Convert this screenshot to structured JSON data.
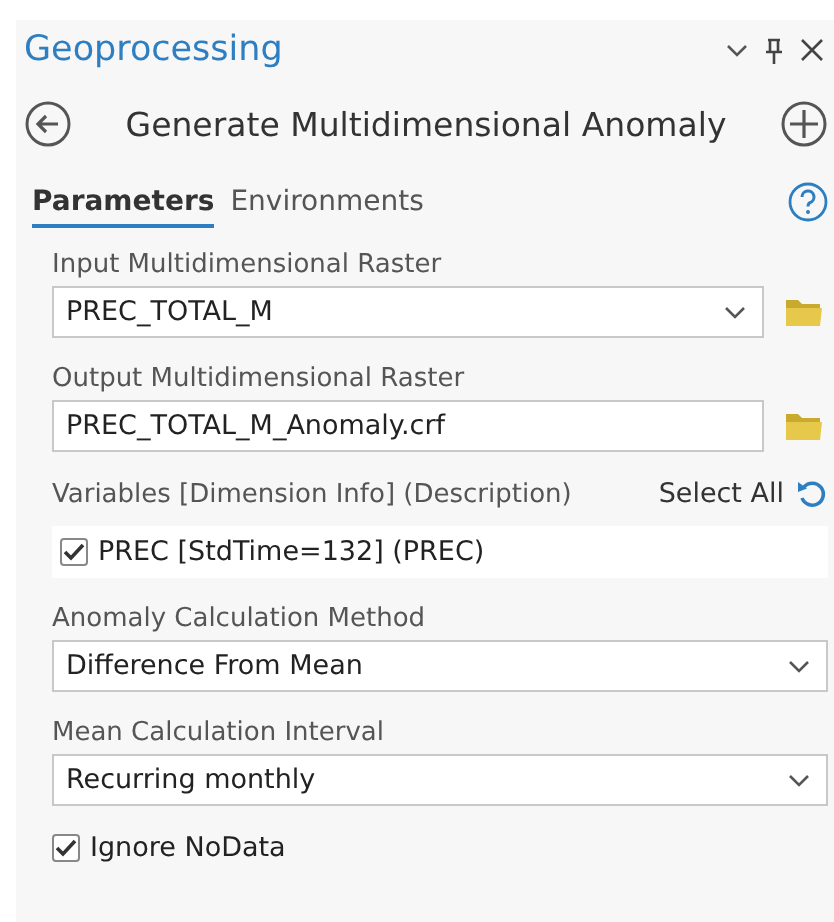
{
  "pane": {
    "title": "Geoprocessing"
  },
  "tool": {
    "title": "Generate Multidimensional Anomaly"
  },
  "tabs": [
    {
      "label": "Parameters",
      "selected": true
    },
    {
      "label": "Environments",
      "selected": false
    }
  ],
  "parameters": [
    {
      "kind": "combo",
      "label": "Input Multidimensional Raster",
      "value": "PREC_TOTAL_M"
    },
    {
      "kind": "text",
      "label": "Output Multidimensional Raster",
      "value": "PREC_TOTAL_M_Anomaly.crf"
    },
    {
      "kind": "variables",
      "label": "Variables [Dimension Info] (Description)",
      "action": "Select All",
      "items": [
        {
          "label": "PREC [StdTime=132] (PREC)",
          "checked": true
        }
      ]
    },
    {
      "kind": "dropdown",
      "label": "Anomaly Calculation Method",
      "value": "Difference From Mean"
    },
    {
      "kind": "dropdown",
      "label": "Mean Calculation Interval",
      "value": "Recurring monthly"
    },
    {
      "kind": "checkbox",
      "label": "Ignore NoData",
      "checked": true
    }
  ]
}
